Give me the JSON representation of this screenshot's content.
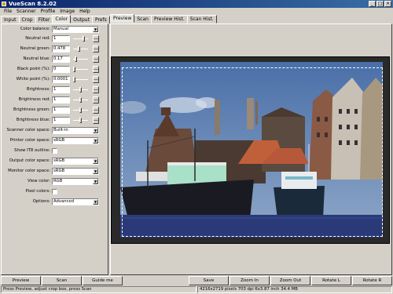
{
  "window": {
    "title": "VueScan 8.2.02",
    "min": "_",
    "max": "□",
    "close": "×"
  },
  "menu": [
    "File",
    "Scanner",
    "Profile",
    "Image",
    "Help"
  ],
  "left_tabs": [
    "Input",
    "Crop",
    "Filter",
    "Color",
    "Output",
    "Prefs"
  ],
  "active_left_tab": "Color",
  "right_tabs": [
    "Preview",
    "Scan",
    "Preview Hist.",
    "Scan Hist."
  ],
  "active_right_tab": "Preview",
  "color_panel": {
    "color_balance": {
      "label": "Color balance:",
      "value": "Manual"
    },
    "neutral_red": {
      "label": "Neutral red:",
      "value": "1"
    },
    "neutral_green": {
      "label": "Neutral green:",
      "value": "0.478"
    },
    "neutral_blue": {
      "label": "Neutral blue:",
      "value": "0.17"
    },
    "black_point": {
      "label": "Black point (%):",
      "value": "0"
    },
    "white_point": {
      "label": "White point (%):",
      "value": "0.0001"
    },
    "brightness": {
      "label": "Brightness:",
      "value": "1"
    },
    "brightness_red": {
      "label": "Brightness red:",
      "value": "1"
    },
    "brightness_green": {
      "label": "Brightness green:",
      "value": "1"
    },
    "brightness_blue": {
      "label": "Brightness blue:",
      "value": "1"
    },
    "scanner_color_space": {
      "label": "Scanner color space:",
      "value": "Built-in"
    },
    "printer_color_space": {
      "label": "Printer color space:",
      "value": "sRGB"
    },
    "show_it8_outline": {
      "label": "Show IT8 outline:"
    },
    "output_color_space": {
      "label": "Output color space:",
      "value": "sRGB"
    },
    "monitor_color_space": {
      "label": "Monitor color space:",
      "value": "sRGB"
    },
    "view_color": {
      "label": "View color:",
      "value": "RGB"
    },
    "pixel_colors": {
      "label": "Pixel colors:"
    },
    "options": {
      "label": "Options:",
      "value": "Advanced"
    }
  },
  "buttons": {
    "preview": "Preview",
    "scan": "Scan",
    "guide_me": "Guide me",
    "save": "Save",
    "zoom_in": "Zoom In",
    "zoom_out": "Zoom Out",
    "rotate_l": "Rotate L",
    "rotate_r": "Rotate R"
  },
  "status": {
    "left": "Press Preview, adjust crop box, press Scan",
    "right": "4216x2719 pixels 703 dpi 6x3.87 inch 34.4 MB"
  },
  "colors": {
    "title_bar": "#0a246a",
    "preview_bg": "#2a2a2a",
    "crop_box": "#ffffff"
  }
}
